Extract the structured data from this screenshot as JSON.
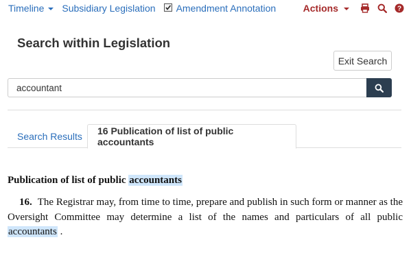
{
  "toolbar": {
    "timeline_label": "Timeline",
    "subsidiary_label": "Subsidiary Legislation",
    "amendment_label": "Amendment Annotation",
    "amendment_checked": true,
    "actions_label": "Actions",
    "icons": [
      "print-icon",
      "search-icon",
      "help-icon"
    ],
    "action_color": "#a52a2a",
    "link_color": "#2a6ebb"
  },
  "search": {
    "title": "Search within Legislation",
    "exit_label": "Exit Search",
    "query": "accountant"
  },
  "tabs": {
    "results_label": "Search Results",
    "active_label": "16 Publication of list of public accountants"
  },
  "content": {
    "heading_prefix": "Publication of list of public ",
    "heading_highlight": "accountants",
    "section_number": "16.",
    "para_text": "The Registrar may, from time to time, prepare and publish in such form or manner as the Oversight Committee may determine a list of the names and particulars of all public ",
    "para_highlight": "accountants",
    "para_suffix": " .",
    "highlight_color": "#cfe6fb"
  }
}
